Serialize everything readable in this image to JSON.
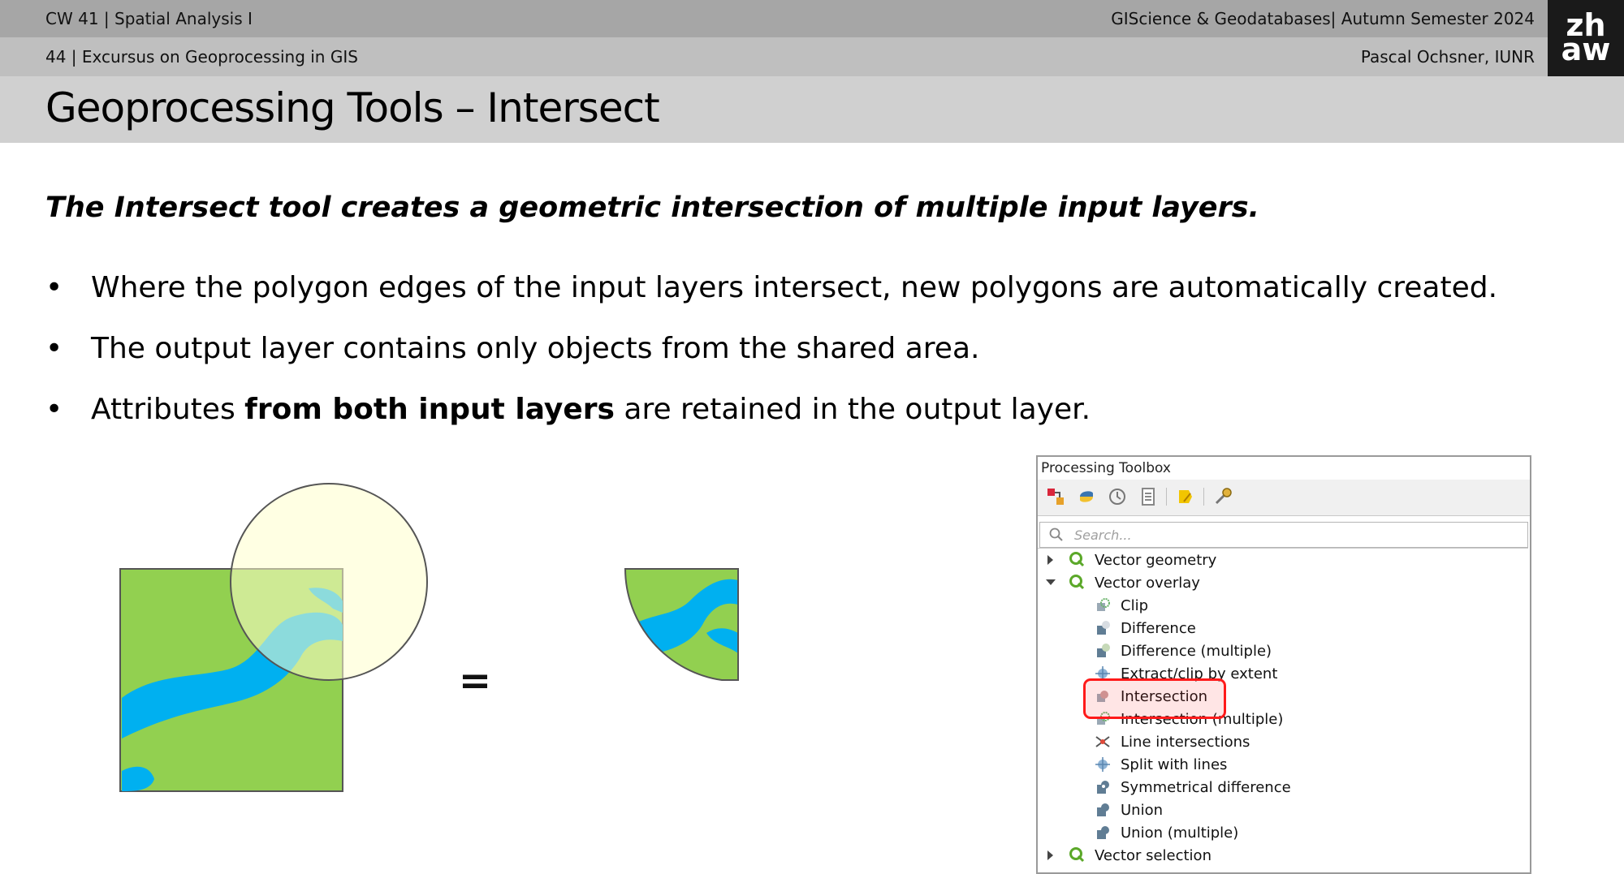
{
  "header": {
    "course_week": "CW 41 | Spatial Analysis I",
    "course_name": "GIScience & Geodatabases| Autumn Semester 2024",
    "slide_info": "44 | Excursus on Geoprocessing in GIS",
    "author": "Pascal Ochsner, IUNR",
    "logo_top": "zh",
    "logo_bottom": "aw"
  },
  "slide": {
    "title": "Geoprocessing Tools – Intersect",
    "lead": "The Intersect tool creates a geometric intersection of multiple input layers.",
    "bullets": [
      {
        "text": "Where the polygon edges of the input layers intersect, new polygons are automatically created."
      },
      {
        "text": "The output layer contains only objects from the shared area."
      },
      {
        "pre": "Attributes ",
        "bold": "from both input layers",
        "post": " are retained in the output layer."
      }
    ],
    "equals": "="
  },
  "colors": {
    "polygon_green": "#92d050",
    "river_blue": "#00b0f0",
    "circle_fill": "#fffde0",
    "highlight": "#ff1a1a"
  },
  "toolbox": {
    "title": "Processing Toolbox",
    "search_placeholder": "Search...",
    "toolbar_icons": [
      "models-icon",
      "python-icon",
      "history-icon",
      "results-icon",
      "edit-in-place-icon",
      "options-icon"
    ],
    "groups": [
      {
        "label": "Vector geometry",
        "expanded": false
      },
      {
        "label": "Vector overlay",
        "expanded": true,
        "items": [
          "Clip",
          "Difference",
          "Difference (multiple)",
          "Extract/clip by extent",
          "Intersection",
          "Intersection (multiple)",
          "Line intersections",
          "Split with lines",
          "Symmetrical difference",
          "Union",
          "Union (multiple)"
        ]
      },
      {
        "label": "Vector selection",
        "expanded": false
      }
    ],
    "selected_item": "Intersection"
  }
}
